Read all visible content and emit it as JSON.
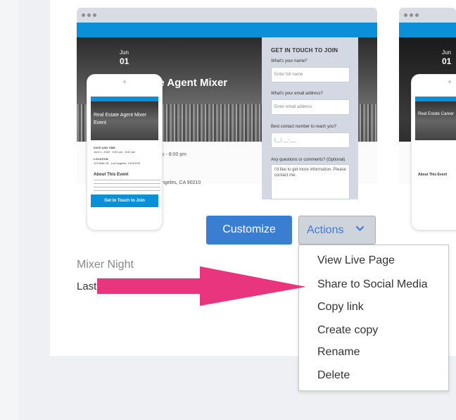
{
  "template_card": {
    "name": "Mixer Night",
    "subtitle": "Last",
    "preview": {
      "date_month": "Jun",
      "date_day": "01",
      "headline": "ate Agent Mixer",
      "time_fragment": "s - 8:00 pm",
      "address_fragment": "ngeles, CA 90210",
      "form": {
        "title": "GET IN TOUCH TO JOIN",
        "fields": [
          {
            "label": "What's your name?",
            "placeholder": "Enter full name"
          },
          {
            "label": "What's your email address?",
            "placeholder": "Enter email address"
          },
          {
            "label": "Best contact number to reach you?",
            "placeholder": "(__) __-___"
          }
        ],
        "comments_label": "Any questions or comments? (Optional)",
        "comments_value": "I'd like to get more information. Please contact me."
      },
      "phone": {
        "title": "Real Estate Agent Mixer Event",
        "date_label": "DATE AND TIME",
        "date_value": "June 1, 2020 · 5:00 pm - 8:00 pm",
        "location_label": "LOCATION",
        "location_value": "123 Main St., Los Angeles, CA 90210",
        "about_heading": "About This Event",
        "cta": "Get In Touch to Join"
      }
    },
    "buttons": {
      "customize": "Customize",
      "actions": "Actions"
    }
  },
  "second_card_preview": {
    "date_month": "Jun",
    "date_day": "01",
    "phone_title": "Real Estate Career",
    "about_heading": "About This Event"
  },
  "actions_menu": {
    "items": [
      "View Live Page",
      "Share to Social Media",
      "Copy link",
      "Create copy",
      "Rename",
      "Delete"
    ]
  },
  "colors": {
    "primary_button": "#3a7ed1",
    "brand_bar": "#0b8fd9",
    "annotation_arrow": "#e8357e"
  },
  "icons": {
    "actions_chevron": "chevron-down-icon",
    "annotation": "pink-arrow-icon"
  }
}
